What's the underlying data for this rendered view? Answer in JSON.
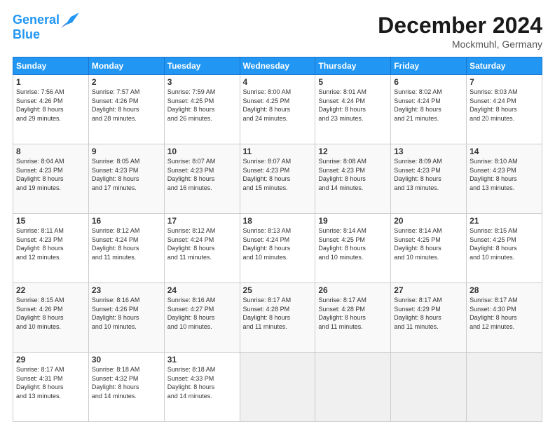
{
  "header": {
    "logo_line1": "General",
    "logo_line2": "Blue",
    "month_title": "December 2024",
    "location": "Mockmuhl, Germany"
  },
  "weekdays": [
    "Sunday",
    "Monday",
    "Tuesday",
    "Wednesday",
    "Thursday",
    "Friday",
    "Saturday"
  ],
  "weeks": [
    [
      {
        "day": "1",
        "info": "Sunrise: 7:56 AM\nSunset: 4:26 PM\nDaylight: 8 hours\nand 29 minutes."
      },
      {
        "day": "2",
        "info": "Sunrise: 7:57 AM\nSunset: 4:26 PM\nDaylight: 8 hours\nand 28 minutes."
      },
      {
        "day": "3",
        "info": "Sunrise: 7:59 AM\nSunset: 4:25 PM\nDaylight: 8 hours\nand 26 minutes."
      },
      {
        "day": "4",
        "info": "Sunrise: 8:00 AM\nSunset: 4:25 PM\nDaylight: 8 hours\nand 24 minutes."
      },
      {
        "day": "5",
        "info": "Sunrise: 8:01 AM\nSunset: 4:24 PM\nDaylight: 8 hours\nand 23 minutes."
      },
      {
        "day": "6",
        "info": "Sunrise: 8:02 AM\nSunset: 4:24 PM\nDaylight: 8 hours\nand 21 minutes."
      },
      {
        "day": "7",
        "info": "Sunrise: 8:03 AM\nSunset: 4:24 PM\nDaylight: 8 hours\nand 20 minutes."
      }
    ],
    [
      {
        "day": "8",
        "info": "Sunrise: 8:04 AM\nSunset: 4:23 PM\nDaylight: 8 hours\nand 19 minutes."
      },
      {
        "day": "9",
        "info": "Sunrise: 8:05 AM\nSunset: 4:23 PM\nDaylight: 8 hours\nand 17 minutes."
      },
      {
        "day": "10",
        "info": "Sunrise: 8:07 AM\nSunset: 4:23 PM\nDaylight: 8 hours\nand 16 minutes."
      },
      {
        "day": "11",
        "info": "Sunrise: 8:07 AM\nSunset: 4:23 PM\nDaylight: 8 hours\nand 15 minutes."
      },
      {
        "day": "12",
        "info": "Sunrise: 8:08 AM\nSunset: 4:23 PM\nDaylight: 8 hours\nand 14 minutes."
      },
      {
        "day": "13",
        "info": "Sunrise: 8:09 AM\nSunset: 4:23 PM\nDaylight: 8 hours\nand 13 minutes."
      },
      {
        "day": "14",
        "info": "Sunrise: 8:10 AM\nSunset: 4:23 PM\nDaylight: 8 hours\nand 13 minutes."
      }
    ],
    [
      {
        "day": "15",
        "info": "Sunrise: 8:11 AM\nSunset: 4:23 PM\nDaylight: 8 hours\nand 12 minutes."
      },
      {
        "day": "16",
        "info": "Sunrise: 8:12 AM\nSunset: 4:24 PM\nDaylight: 8 hours\nand 11 minutes."
      },
      {
        "day": "17",
        "info": "Sunrise: 8:12 AM\nSunset: 4:24 PM\nDaylight: 8 hours\nand 11 minutes."
      },
      {
        "day": "18",
        "info": "Sunrise: 8:13 AM\nSunset: 4:24 PM\nDaylight: 8 hours\nand 10 minutes."
      },
      {
        "day": "19",
        "info": "Sunrise: 8:14 AM\nSunset: 4:25 PM\nDaylight: 8 hours\nand 10 minutes."
      },
      {
        "day": "20",
        "info": "Sunrise: 8:14 AM\nSunset: 4:25 PM\nDaylight: 8 hours\nand 10 minutes."
      },
      {
        "day": "21",
        "info": "Sunrise: 8:15 AM\nSunset: 4:25 PM\nDaylight: 8 hours\nand 10 minutes."
      }
    ],
    [
      {
        "day": "22",
        "info": "Sunrise: 8:15 AM\nSunset: 4:26 PM\nDaylight: 8 hours\nand 10 minutes."
      },
      {
        "day": "23",
        "info": "Sunrise: 8:16 AM\nSunset: 4:26 PM\nDaylight: 8 hours\nand 10 minutes."
      },
      {
        "day": "24",
        "info": "Sunrise: 8:16 AM\nSunset: 4:27 PM\nDaylight: 8 hours\nand 10 minutes."
      },
      {
        "day": "25",
        "info": "Sunrise: 8:17 AM\nSunset: 4:28 PM\nDaylight: 8 hours\nand 11 minutes."
      },
      {
        "day": "26",
        "info": "Sunrise: 8:17 AM\nSunset: 4:28 PM\nDaylight: 8 hours\nand 11 minutes."
      },
      {
        "day": "27",
        "info": "Sunrise: 8:17 AM\nSunset: 4:29 PM\nDaylight: 8 hours\nand 11 minutes."
      },
      {
        "day": "28",
        "info": "Sunrise: 8:17 AM\nSunset: 4:30 PM\nDaylight: 8 hours\nand 12 minutes."
      }
    ],
    [
      {
        "day": "29",
        "info": "Sunrise: 8:17 AM\nSunset: 4:31 PM\nDaylight: 8 hours\nand 13 minutes."
      },
      {
        "day": "30",
        "info": "Sunrise: 8:18 AM\nSunset: 4:32 PM\nDaylight: 8 hours\nand 14 minutes."
      },
      {
        "day": "31",
        "info": "Sunrise: 8:18 AM\nSunset: 4:33 PM\nDaylight: 8 hours\nand 14 minutes."
      },
      null,
      null,
      null,
      null
    ]
  ]
}
